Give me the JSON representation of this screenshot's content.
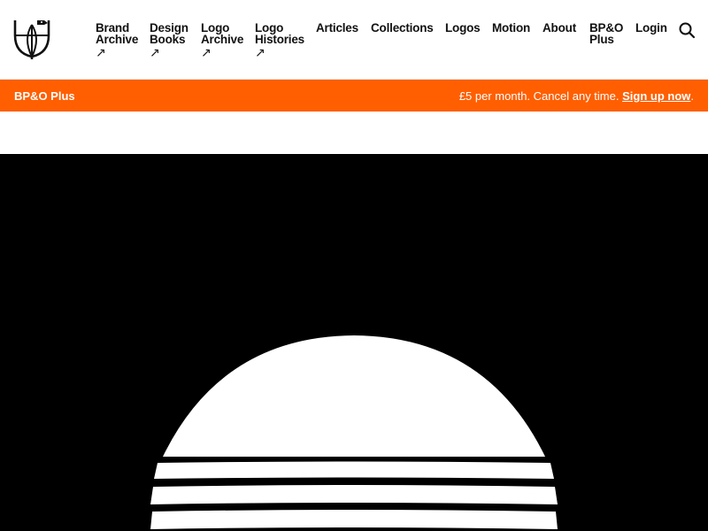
{
  "header": {
    "logo_icon": "bird-globe-logo-icon",
    "nav": [
      {
        "label_line1": "Brand",
        "label_line2": "Archive",
        "external": "↗"
      },
      {
        "label_line1": "Design",
        "label_line2": "Books",
        "external": "↗"
      },
      {
        "label_line1": "Logo",
        "label_line2": "Archive",
        "external": "↗"
      },
      {
        "label_line1": "Logo",
        "label_line2": "Histories",
        "external": "↗"
      },
      {
        "label_line1": "Articles"
      },
      {
        "label_line1": "Collections"
      },
      {
        "label_line1": "Logos"
      },
      {
        "label_line1": "Motion"
      },
      {
        "label_line1": "About"
      },
      {
        "label_line1": "BP&O",
        "label_line2": "Plus"
      },
      {
        "label_line1": "Login"
      }
    ],
    "search_icon": "search-icon"
  },
  "banner": {
    "title": "BP&O Plus",
    "text": "£5 per month. Cancel any time.",
    "link": "Sign up now",
    "trailing": ".",
    "color": "#ff5f00"
  },
  "hero": {
    "image": "sunset-logo-graphic",
    "background": "#000000"
  }
}
